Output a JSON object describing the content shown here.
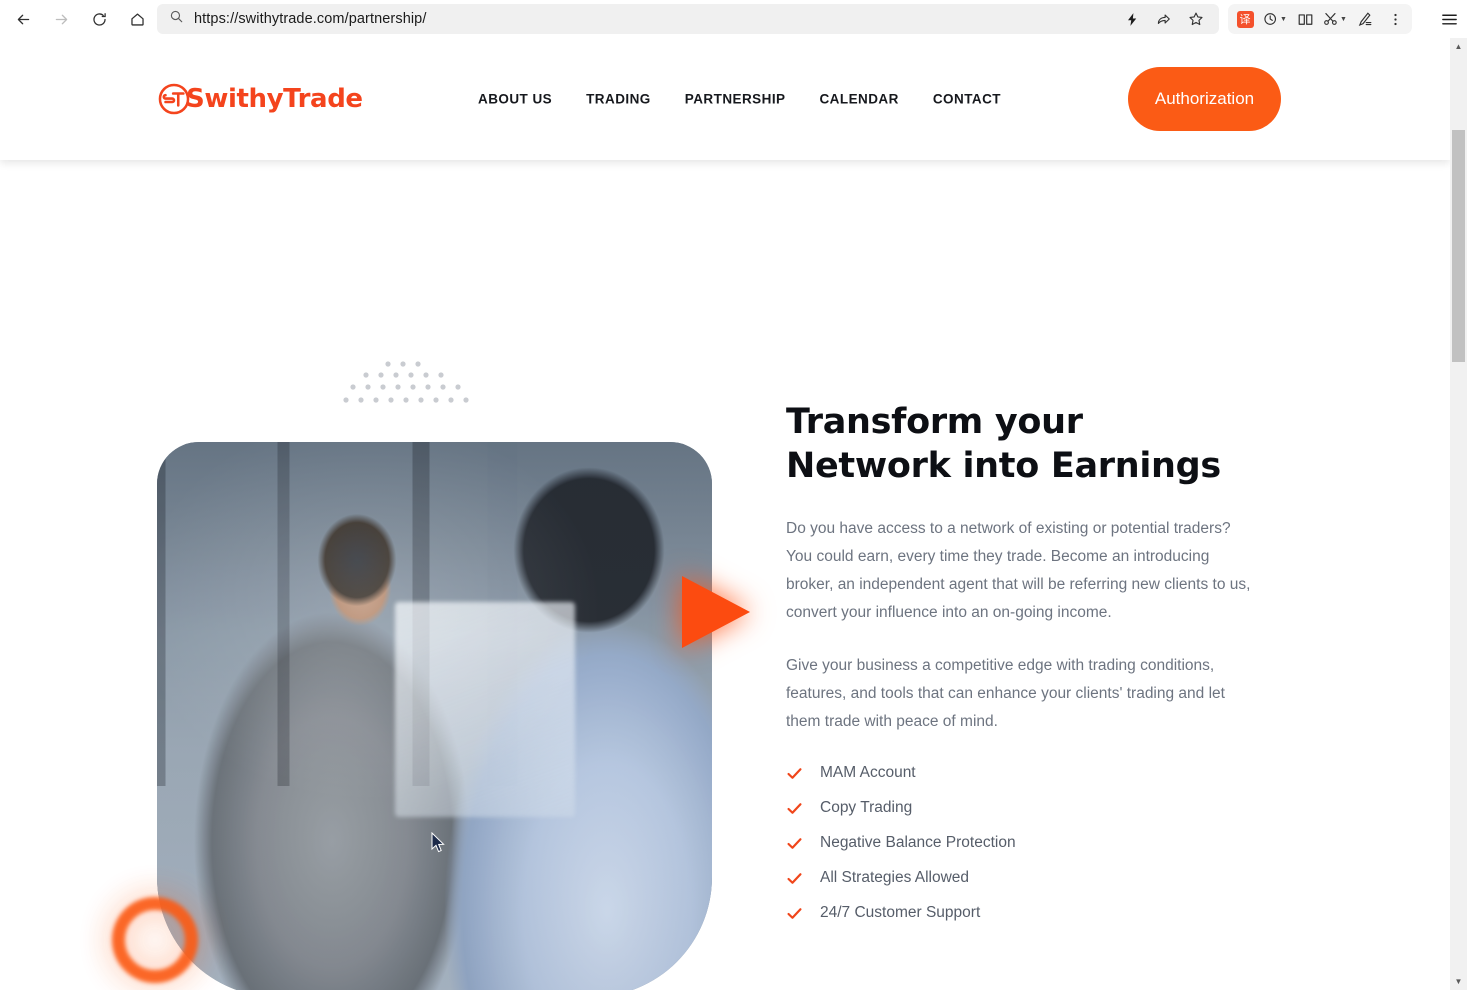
{
  "browser": {
    "url": "https://swithytrade.com/partnership/",
    "nav": {
      "back": "Back",
      "forward": "Forward",
      "reload": "Refresh",
      "home": "Home"
    },
    "urlbar_actions": {
      "reading_mode": "Immersive Reader",
      "share": "Share this page",
      "favorite": "Add this page to favorites"
    },
    "toolbar": {
      "translate": "译",
      "translate_name": "Translate this page",
      "history": "History",
      "collections": "Collections",
      "split_screen": "Screenshot / Split",
      "editor": "Editor",
      "more": "Settings and more",
      "sidebar": "Browser essentials"
    }
  },
  "site": {
    "logo_text": "SwithyTrade",
    "nav_items": [
      {
        "label": "ABOUT US"
      },
      {
        "label": "TRADING"
      },
      {
        "label": "PARTNERSHIP"
      },
      {
        "label": "CALENDAR"
      },
      {
        "label": "CONTACT"
      }
    ],
    "auth_button": "Authorization",
    "accent_color": "#fb5b15",
    "logo_color": "#f4441d"
  },
  "hero": {
    "title": "Transform your Network into Earnings",
    "paragraphs": [
      "Do you have access to a network of existing or potential traders? You could earn, every time they trade. Become an introducing broker, an independent agent that will be referring new clients to us, convert your influence into an on-going income.",
      "Give your business a competitive edge with trading conditions, features, and tools that can enhance your clients' trading and let them trade with peace of mind."
    ],
    "features": [
      {
        "label": "MAM Account"
      },
      {
        "label": "Copy Trading"
      },
      {
        "label": "Negative Balance Protection"
      },
      {
        "label": "All Strategies Allowed"
      },
      {
        "label": "24/7 Customer Support"
      }
    ],
    "image_alt": "Two businessmen shaking hands in an office"
  }
}
